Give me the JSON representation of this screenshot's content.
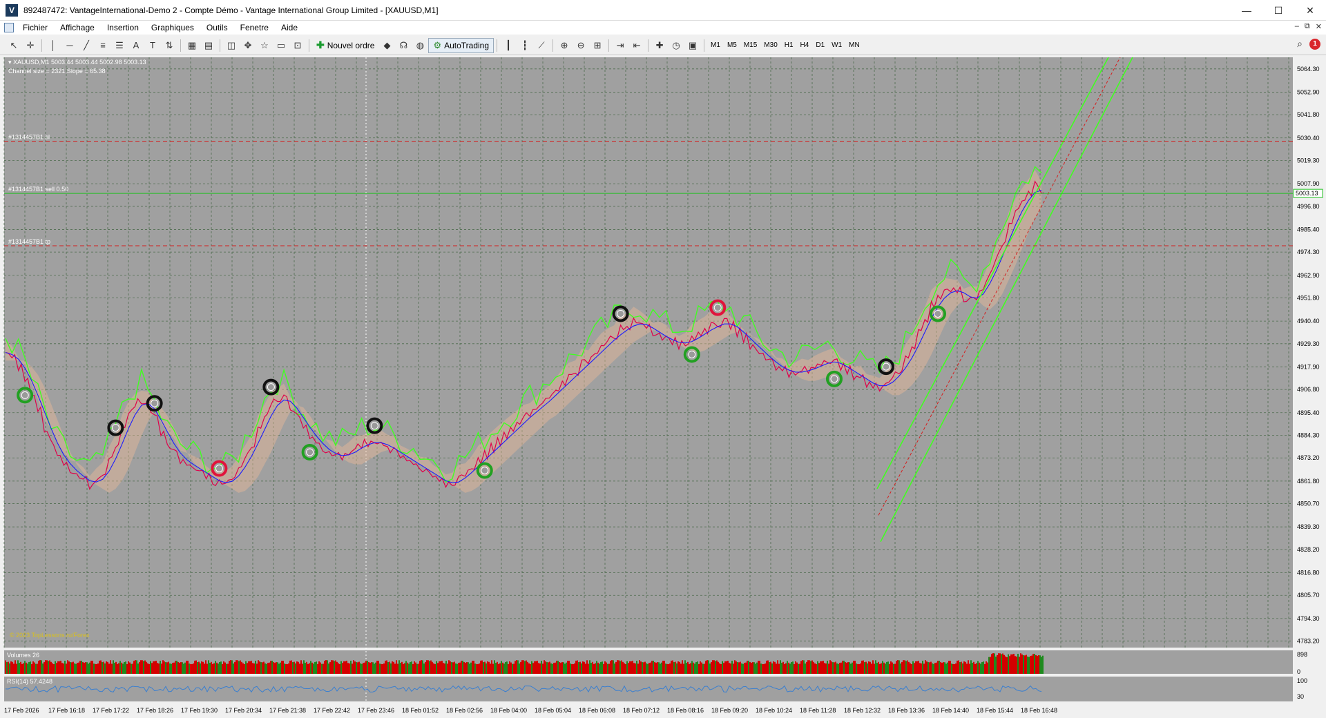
{
  "window": {
    "icon_letter": "V",
    "title": "892487472: VantageInternational-Demo 2 - Compte Démo - Vantage International Group Limited - [XAUUSD,M1]",
    "minimize": "—",
    "maximize": "☐",
    "close": "✕"
  },
  "menu": {
    "items": [
      "Fichier",
      "Affichage",
      "Insertion",
      "Graphiques",
      "Outils",
      "Fenetre",
      "Aide"
    ],
    "mdi": [
      "–",
      "⧉",
      "✕"
    ]
  },
  "toolbar": {
    "new_order": "Nouvel ordre",
    "autotrading": "AutoTrading",
    "timeframes": [
      "M1",
      "M5",
      "M15",
      "M30",
      "H1",
      "H4",
      "D1",
      "W1",
      "MN"
    ],
    "notification_count": "1"
  },
  "chart": {
    "symbol_info": "XAUUSD,M1  5003.44 5003.44 5002.98 5003.13",
    "channel_info": "Channel size = 2321 Slope = 65.38",
    "current_price": "5003.13",
    "price_labels": [
      "5064.30",
      "5052.90",
      "5041.80",
      "5030.40",
      "5019.30",
      "5007.90",
      "4996.80",
      "4985.40",
      "4974.30",
      "4962.90",
      "4951.80",
      "4940.40",
      "4929.30",
      "4917.90",
      "4906.80",
      "4895.40",
      "4884.30",
      "4873.20",
      "4861.80",
      "4850.70",
      "4839.30",
      "4828.20",
      "4816.80",
      "4805.70",
      "4794.30",
      "4783.20"
    ],
    "time_labels": [
      "17 Feb 2026",
      "17 Feb 16:18",
      "17 Feb 17:22",
      "17 Feb 18:26",
      "17 Feb 19:30",
      "17 Feb 20:34",
      "17 Feb 21:38",
      "17 Feb 22:42",
      "17 Feb 23:46",
      "18 Feb 01:52",
      "18 Feb 02:56",
      "18 Feb 04:00",
      "18 Feb 05:04",
      "18 Feb 06:08",
      "18 Feb 07:12",
      "18 Feb 08:16",
      "18 Feb 09:20",
      "18 Feb 10:24",
      "18 Feb 11:28",
      "18 Feb 12:32",
      "18 Feb 13:36",
      "18 Feb 14:40",
      "18 Feb 15:44",
      "18 Feb 16:48"
    ],
    "order_lines": [
      {
        "label": "#1314457B1 sl",
        "price": 5028.8,
        "color": "#d41f1f"
      },
      {
        "label": "#1314457B1 sell 0.50",
        "price": 5003.13,
        "color": "#22c022"
      },
      {
        "label": "#1314457B1 tp",
        "price": 4977.4,
        "color": "#d41f1f"
      }
    ],
    "watermark": "© 2023 TopLessons.ru/Forex",
    "volume_label": "Volumes 26",
    "volume_scale": [
      "898",
      "0"
    ],
    "rsi_label": "RSI(14) 57.4248",
    "rsi_scale": [
      "100",
      "30"
    ],
    "colors": {
      "background": "#a0a0a0",
      "grid": "#4d6b4d",
      "candles": "#e0004a",
      "ma_blue": "#1a1aff",
      "fast_green": "#40ff20",
      "cloud": "#e8b896",
      "rsi": "#3a7fd0",
      "volume_up": "#1e8a1e",
      "volume_down": "#d40000"
    }
  },
  "chart_data": {
    "type": "line",
    "series": [
      {
        "values": [
          4925,
          4922,
          4918,
          4912,
          4904,
          4896,
          4888,
          4880,
          4874,
          4870,
          4867,
          4864,
          4862,
          4860,
          4862,
          4866,
          4872,
          4880,
          4888,
          4895,
          4900,
          4902,
          4898,
          4892,
          4886,
          4880,
          4875,
          4872,
          4870,
          4868,
          4866,
          4864,
          4862,
          4860,
          4861,
          4864,
          4868,
          4874,
          4880,
          4887,
          4894,
          4900,
          4903,
          4902,
          4898,
          4893,
          4888,
          4884,
          4880,
          4877,
          4875,
          4874,
          4874,
          4876,
          4878,
          4880,
          4881,
          4881,
          4880,
          4878,
          4876,
          4874,
          4872,
          4870,
          4868,
          4866,
          4864,
          4862,
          4860,
          4861,
          4863,
          4866,
          4869,
          4872,
          4875,
          4878,
          4881,
          4884,
          4887,
          4890,
          4893,
          4896,
          4898,
          4901,
          4904,
          4907,
          4910,
          4913,
          4916,
          4919,
          4922,
          4925,
          4928,
          4931,
          4934,
          4936,
          4938,
          4940,
          4939,
          4937,
          4935,
          4933,
          4931,
          4930,
          4929,
          4930,
          4932,
          4934,
          4936,
          4938,
          4939,
          4940,
          4938,
          4935,
          4932,
          4929,
          4926,
          4923,
          4920,
          4918,
          4916,
          4915,
          4915,
          4916,
          4917,
          4918,
          4920,
          4921,
          4920,
          4918,
          4916,
          4914,
          4912,
          4910,
          4908,
          4908,
          4910,
          4913,
          4917,
          4922,
          4928,
          4935,
          4942,
          4948,
          4952,
          4955,
          4956,
          4955,
          4952,
          4950,
          4953,
          4958,
          4965,
          4972,
          4980,
          4988,
          4995,
          5000,
          5004,
          5007,
          5003
        ]
      }
    ]
  }
}
